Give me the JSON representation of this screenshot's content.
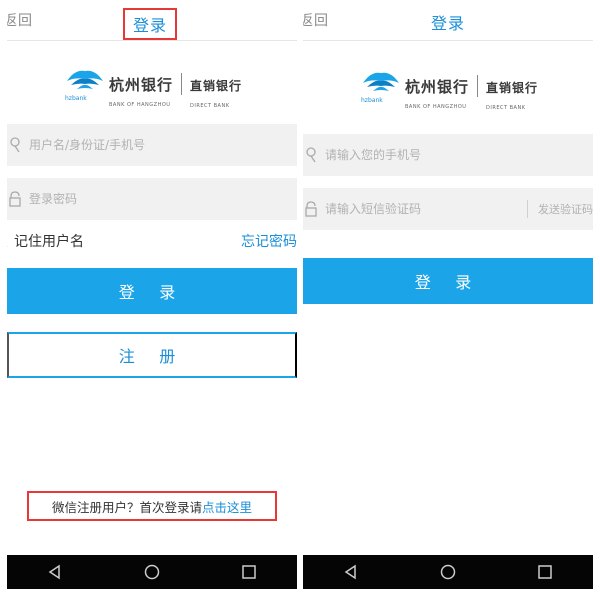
{
  "left_screen": {
    "back_label": "返回",
    "title": "登录",
    "logo": {
      "bank_name": "杭州银行",
      "bank_name_en": "BANK OF HANGZHOU",
      "abbr": "hzbank",
      "direct": "直销银行",
      "direct_en": "DIRECT BANK"
    },
    "username_placeholder": "用户名/身份证/手机号",
    "password_placeholder": "登录密码",
    "remember_label": "记住用户名",
    "forgot_label": "忘记密码",
    "login_label": "登 录",
    "register_label": "注 册",
    "wechat_text": "微信注册用户？首次登录请",
    "wechat_link": "点击这里"
  },
  "right_screen": {
    "back_label": "返回",
    "title": "登录",
    "logo": {
      "bank_name": "杭州银行",
      "bank_name_en": "BANK OF HANGZHOU",
      "abbr": "hzbank",
      "direct": "直销银行",
      "direct_en": "DIRECT BANK"
    },
    "phone_placeholder": "请输入您的手机号",
    "sms_placeholder": "请输入短信验证码",
    "send_code_label": "发送验证码",
    "login_label": "登 录"
  },
  "colors": {
    "accent": "#1ba5e8",
    "link": "#1a8fd8",
    "highlight_border": "#e53935",
    "input_bg": "#f1f1f1",
    "navbar_bg": "#050505"
  },
  "icons": {
    "user": "user-icon",
    "lock": "lock-icon",
    "phone": "phone-icon",
    "shield": "shield-icon",
    "back": "back-triangle-icon",
    "home": "home-circle-icon",
    "recent": "recent-square-icon"
  }
}
